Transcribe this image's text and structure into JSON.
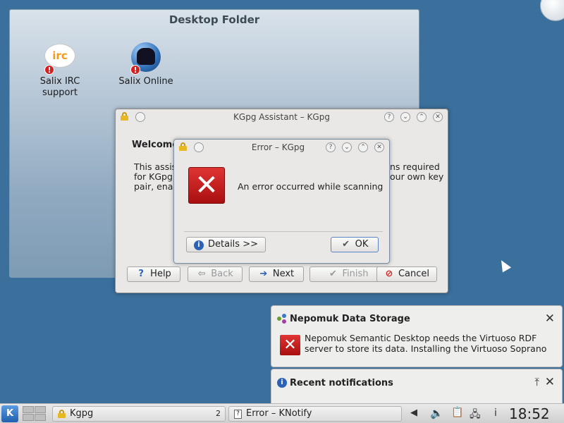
{
  "desktop_folder": {
    "title": "Desktop Folder",
    "icons": [
      {
        "label_line1": "Salix IRC",
        "label_line2": "support",
        "icon": "irc-icon",
        "badge": "!"
      },
      {
        "label_line1": "Salix Online",
        "label_line2": "",
        "icon": "globe-tree-icon",
        "badge": "!"
      }
    ]
  },
  "kgpg_window": {
    "title": "KGpg Assistant – KGpg",
    "welcome_heading": "Welcome",
    "body_left_1": "This assis",
    "body_left_2": "for KGpg",
    "body_left_3": "pair, enab",
    "body_right_1": "ns required",
    "body_right_2": "our own key",
    "buttons": {
      "help": "Help",
      "back": "Back",
      "next": "Next",
      "finish": "Finish",
      "cancel": "Cancel"
    }
  },
  "error_dialog": {
    "title": "Error – KGpg",
    "message": "An error occurred while scanning",
    "details_button": "Details >>",
    "ok_button": "OK"
  },
  "notifications": {
    "nepomuk": {
      "title": "Nepomuk Data Storage",
      "line1": "Nepomuk Semantic Desktop needs the Virtuoso RDF",
      "line2": "server to store its data. Installing the Virtuoso Soprano"
    },
    "recent_title": "Recent notifications"
  },
  "taskbar": {
    "task_kgpg": "Kgpg",
    "task_kgpg_count": "2",
    "task_error": "Error – KNotify",
    "clock": "18:52",
    "info_glyph": "i"
  },
  "colors": {
    "desktop_bg": "#3b6f9c",
    "error_red": "#d42020",
    "accent_blue": "#2b62b8"
  }
}
